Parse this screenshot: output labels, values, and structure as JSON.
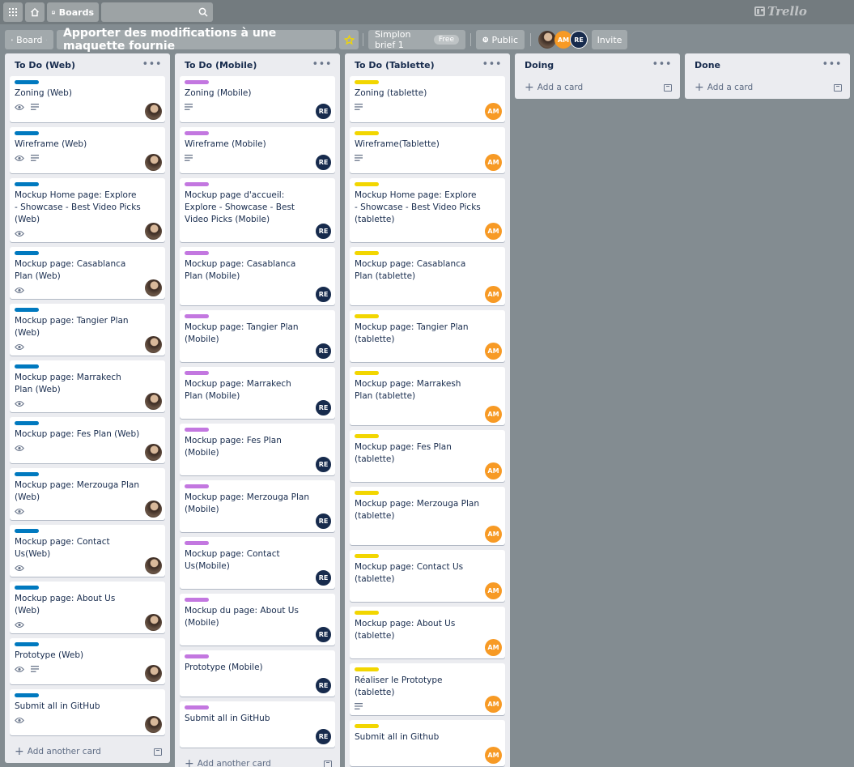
{
  "topbar": {
    "boards_label": "Boards",
    "logo": "Trello"
  },
  "board": {
    "view_label": "Board",
    "title": "Apporter des modifications à une maquette fournie",
    "team": "Simplon brief 1",
    "team_badge": "Free",
    "visibility": "Public",
    "invite_label": "Invite",
    "members": [
      "AM",
      "RE"
    ]
  },
  "colors": {
    "background": "#838c91",
    "web_label": "#0079bf",
    "mobile_label": "#c377e0",
    "tablet_label": "#f2d600",
    "am_avatar": "#f79a25",
    "re_avatar": "#172b4d"
  },
  "lists": [
    {
      "title": "To Do (Web)",
      "footer": "Add another card",
      "cards": [
        {
          "title": "Zoning (Web)",
          "badges": [
            "eye",
            "desc"
          ]
        },
        {
          "title": "Wireframe (Web)",
          "badges": [
            "eye",
            "desc"
          ]
        },
        {
          "title": "Mockup Home page: Explore - Showcase - Best Video Picks (Web)",
          "badges": [
            "eye"
          ]
        },
        {
          "title": "Mockup page: Casablanca Plan (Web)",
          "badges": [
            "eye"
          ]
        },
        {
          "title": "Mockup page: Tangier Plan (Web)",
          "badges": [
            "eye"
          ]
        },
        {
          "title": "Mockup page: Marrakech Plan (Web)",
          "badges": [
            "eye"
          ]
        },
        {
          "title": "Mockup page: Fes Plan (Web)",
          "badges": [
            "eye"
          ]
        },
        {
          "title": "Mockup page: Merzouga Plan (Web)",
          "badges": [
            "eye"
          ]
        },
        {
          "title": "Mockup page: Contact Us(Web)",
          "badges": [
            "eye"
          ]
        },
        {
          "title": "Mockup page: About Us (Web)",
          "badges": [
            "eye"
          ]
        },
        {
          "title": "Prototype (Web)",
          "badges": [
            "eye",
            "desc"
          ]
        },
        {
          "title": "Submit all in GitHub",
          "badges": [
            "eye"
          ]
        }
      ]
    },
    {
      "title": "To Do (Mobile)",
      "footer": "Add another card",
      "cards": [
        {
          "title": "Zoning (Mobile)",
          "badges": [
            "desc"
          ]
        },
        {
          "title": "Wireframe (Mobile)",
          "badges": [
            "desc"
          ]
        },
        {
          "title": "Mockup page d'accueil: Explore - Showcase - Best Video Picks (Mobile)",
          "badges": []
        },
        {
          "title": "Mockup page: Casablanca Plan (Mobile)",
          "badges": []
        },
        {
          "title": "Mockup page: Tangier Plan (Mobile)",
          "badges": []
        },
        {
          "title": "Mockup page: Marrakech Plan (Mobile)",
          "badges": []
        },
        {
          "title": "Mockup page: Fes Plan (Mobile)",
          "badges": []
        },
        {
          "title": "Mockup page: Merzouga Plan (Mobile)",
          "badges": []
        },
        {
          "title": "Mockup page: Contact Us(Mobile)",
          "badges": []
        },
        {
          "title": "Mockup du page: About Us (Mobile)",
          "badges": []
        },
        {
          "title": "Prototype (Mobile)",
          "badges": []
        },
        {
          "title": "Submit all in GitHub",
          "badges": []
        }
      ]
    },
    {
      "title": "To Do (Tablette)",
      "footer": "Add another card",
      "cards": [
        {
          "title": "Zoning (tablette)",
          "badges": [
            "desc"
          ]
        },
        {
          "title": "Wireframe(Tablette)",
          "badges": [
            "desc"
          ]
        },
        {
          "title": "Mockup Home page: Explore - Showcase - Best Video Picks (tablette)",
          "badges": []
        },
        {
          "title": "Mockup page: Casablanca Plan (tablette)",
          "badges": []
        },
        {
          "title": "Mockup page: Tangier Plan (tablette)",
          "badges": []
        },
        {
          "title": "Mockup page: Marrakesh Plan (tablette)",
          "badges": []
        },
        {
          "title": "Mockup page: Fes Plan (tablette)",
          "badges": []
        },
        {
          "title": "Mockup page: Merzouga Plan (tablette)",
          "badges": []
        },
        {
          "title": "Mockup page: Contact Us (tablette)",
          "badges": []
        },
        {
          "title": "Mockup page: About Us (tablette)",
          "badges": []
        },
        {
          "title": "Réaliser le Prototype (tablette)",
          "badges": [
            "desc"
          ]
        },
        {
          "title": "Submit all in Github",
          "badges": []
        }
      ]
    },
    {
      "title": "Doing",
      "footer": "Add a card",
      "cards": []
    },
    {
      "title": "Done",
      "footer": "Add a card",
      "cards": []
    }
  ]
}
